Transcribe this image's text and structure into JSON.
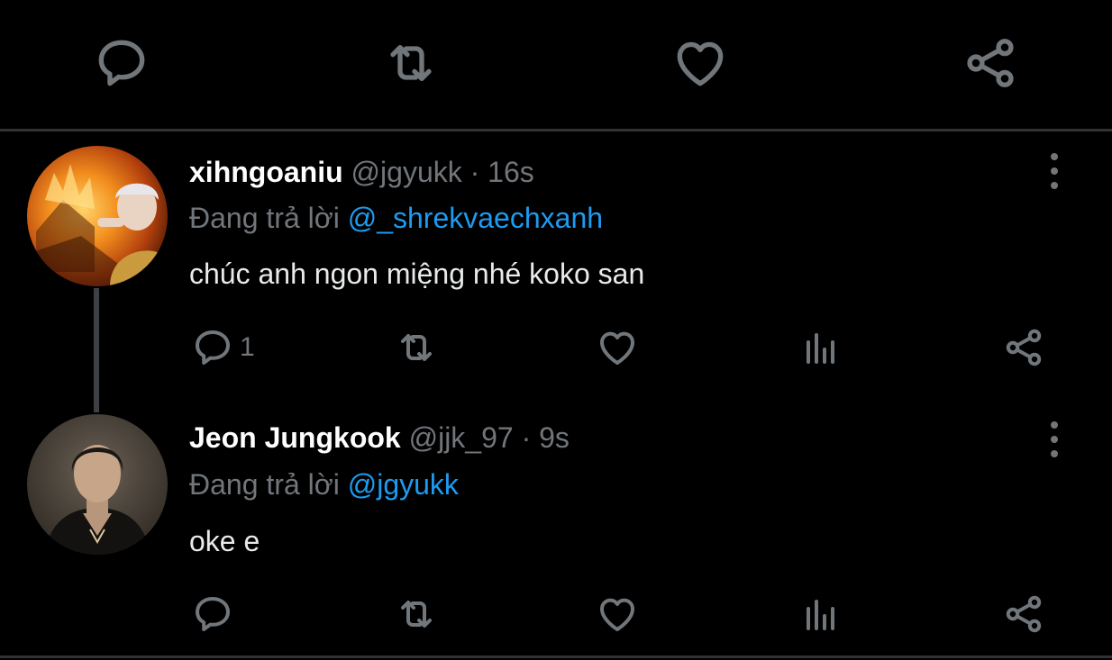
{
  "top_actions": [
    {
      "name": "reply",
      "icon": "comment-icon"
    },
    {
      "name": "retweet",
      "icon": "retweet-icon"
    },
    {
      "name": "like",
      "icon": "heart-icon"
    },
    {
      "name": "share",
      "icon": "share-icon"
    }
  ],
  "tweets": [
    {
      "display_name": "xihngoaniu",
      "handle": "@jgyukk",
      "separator": "·",
      "time": "16s",
      "reply_prefix": "Đang trả lời",
      "reply_to": "@_shrekvaechxanh",
      "text": "chúc anh ngon miệng nhé koko san",
      "reply_count": "1",
      "avatar_icon": "avatar-burning-house"
    },
    {
      "display_name": "Jeon Jungkook",
      "handle": "@jjk_97",
      "separator": "·",
      "time": "9s",
      "reply_prefix": "Đang trả lời",
      "reply_to": "@jgyukk",
      "text": "oke e",
      "reply_count": "",
      "avatar_icon": "avatar-portrait"
    }
  ],
  "colors": {
    "background": "#000000",
    "secondary_text": "#71767b",
    "mention": "#1d9bf0",
    "primary_text": "#e7e9ea"
  }
}
